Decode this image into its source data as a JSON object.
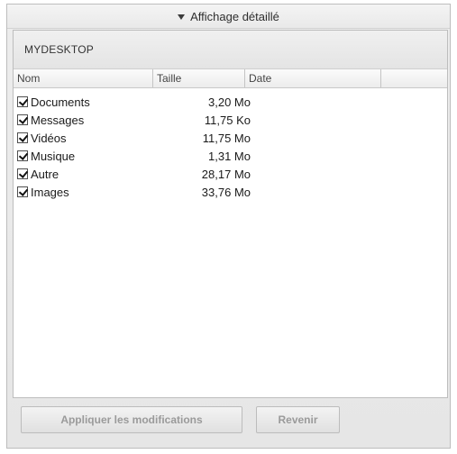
{
  "section": {
    "title": "Affichage détaillé"
  },
  "panel": {
    "title": "MYDESKTOP"
  },
  "table": {
    "columns": [
      "Nom",
      "Taille",
      "Date",
      ""
    ],
    "rows": [
      {
        "name": "Documents",
        "size": "3,20 Mo",
        "checked": true
      },
      {
        "name": "Messages",
        "size": "11,75 Ko",
        "checked": true
      },
      {
        "name": "Vidéos",
        "size": "11,75 Mo",
        "checked": true
      },
      {
        "name": "Musique",
        "size": "1,31 Mo",
        "checked": true
      },
      {
        "name": "Autre",
        "size": "28,17 Mo",
        "checked": true
      },
      {
        "name": "Images",
        "size": "33,76 Mo",
        "checked": true
      }
    ]
  },
  "buttons": {
    "apply": "Appliquer les modifications",
    "revert": "Revenir"
  }
}
